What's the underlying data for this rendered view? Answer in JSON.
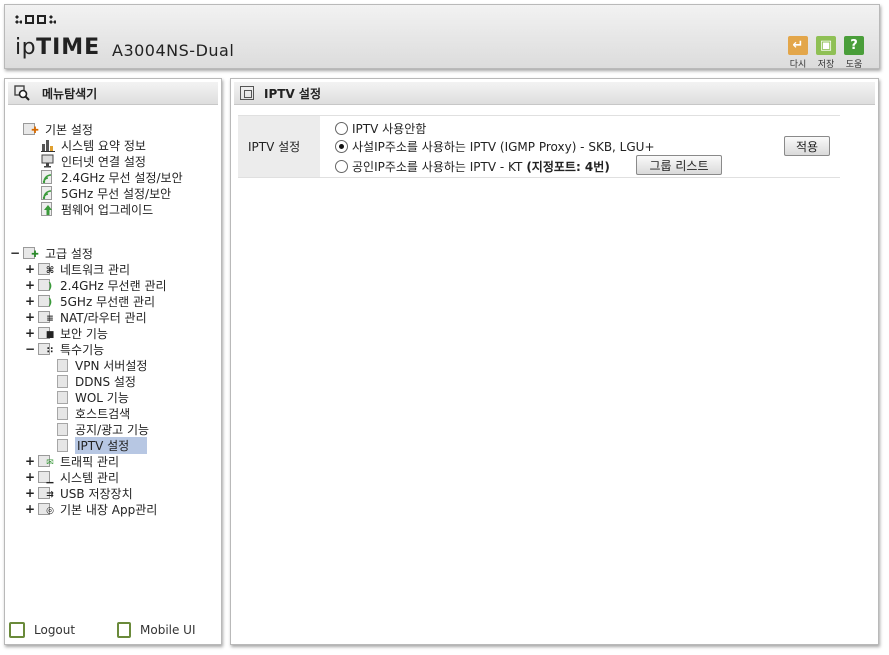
{
  "header": {
    "brand_prefix": "ip",
    "brand_bold": "TIME",
    "model": "A3004NS-Dual",
    "buttons": [
      {
        "label": "다시",
        "icon": "undo-icon",
        "color": "#e3a64a"
      },
      {
        "label": "저장",
        "icon": "save-icon",
        "color": "#8fc055"
      },
      {
        "label": "도움",
        "icon": "help-icon",
        "color": "#4a9e3a"
      }
    ]
  },
  "sidebar": {
    "title": "메뉴탐색기",
    "basic": {
      "label": "기본 설정",
      "items": [
        "시스템 요약 정보",
        "인터넷 연결 설정",
        "2.4GHz 무선 설정/보안",
        "5GHz 무선 설정/보안",
        "펌웨어 업그레이드"
      ]
    },
    "advanced": {
      "label": "고급 설정",
      "items": [
        "네트워크 관리",
        "2.4GHz 무선랜 관리",
        "5GHz 무선랜 관리",
        "NAT/라우터 관리",
        "보안 기능",
        "특수기능"
      ],
      "special_items": [
        "VPN 서버설정",
        "DDNS 설정",
        "WOL 기능",
        "호스트검색",
        "공지/광고 기능",
        "IPTV 설정"
      ],
      "more_items": [
        "트래픽 관리",
        "시스템 관리",
        "USB 저장장치",
        "기본 내장 App관리"
      ],
      "selected": "IPTV 설정"
    },
    "footer": {
      "logout": "Logout",
      "mobile": "Mobile UI"
    }
  },
  "main": {
    "title": "IPTV 설정",
    "field_label": "IPTV 설정",
    "options": [
      {
        "text": "IPTV 사용안함",
        "checked": false
      },
      {
        "text": "사설IP주소를 사용하는 IPTV (IGMP Proxy) - SKB, LGU+",
        "checked": true
      },
      {
        "text": "공인IP주소를 사용하는 IPTV - KT",
        "bold_suffix": "(지정포트: 4번)",
        "checked": false
      }
    ],
    "group_list_button": "그룹 리스트",
    "apply_button": "적용"
  }
}
